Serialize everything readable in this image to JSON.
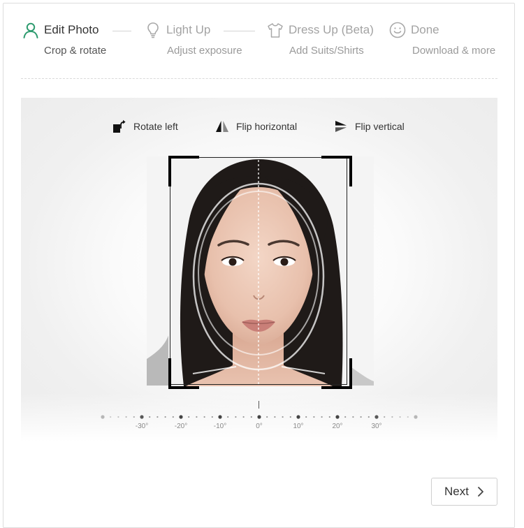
{
  "steps": [
    {
      "title": "Edit Photo",
      "subtitle": "Crop & rotate",
      "state": "active",
      "icon": "person-icon"
    },
    {
      "title": "Light Up",
      "subtitle": "Adjust exposure",
      "state": "inactive",
      "icon": "lightbulb-icon"
    },
    {
      "title": "Dress Up (Beta)",
      "subtitle": "Add Suits/Shirts",
      "state": "inactive",
      "icon": "shirt-icon"
    },
    {
      "title": "Done",
      "subtitle": "Download & more",
      "state": "inactive",
      "icon": "smiley-icon"
    }
  ],
  "tools": {
    "rotate_left": "Rotate left",
    "flip_horizontal": "Flip horizontal",
    "flip_vertical": "Flip vertical"
  },
  "dial": {
    "labels": [
      "-30°",
      "-20°",
      "-10°",
      "0°",
      "10°",
      "20°",
      "30°"
    ],
    "value_degrees": 0
  },
  "next_button": {
    "label": "Next"
  },
  "colors": {
    "accent": "#2e9b6f",
    "inactive": "#a3a3a3",
    "text": "#333333"
  }
}
